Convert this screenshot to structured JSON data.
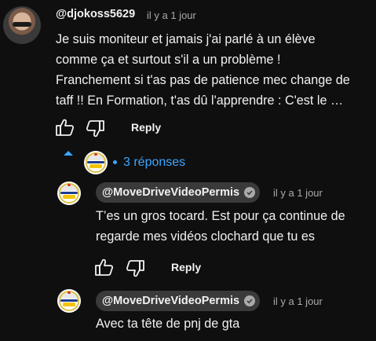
{
  "comment": {
    "author": "@djokoss5629",
    "time": "il y a 1 jour",
    "lines": [
      "Je suis moniteur et jamais j'ai parlé à un élève",
      "comme ça et surtout s'il a un problème !",
      "Franchement si t'as pas de patience mec change de",
      "taff !! En Formation, t'as dû l'apprendre : C'est le …"
    ],
    "reply_label": "Reply"
  },
  "replies_toggle": {
    "label": "3 réponses"
  },
  "replies": [
    {
      "author": "@MoveDriveVideoPermis",
      "time": "il y a 1 jour",
      "lines": [
        "T’es un gros tocard. Est pour ça continue de",
        "regarde mes vidéos clochard que tu es"
      ],
      "reply_label": "Reply"
    },
    {
      "author": "@MoveDriveVideoPermis",
      "time": "il y a 1 jour",
      "lines": [
        "Avec ta tête de pnj de gta"
      ]
    }
  ],
  "colors": {
    "background": "#0f0f0f",
    "text": "#f1f1f1",
    "muted": "#aaaaaa",
    "link": "#3ea6ff",
    "pill": "#3a3a3a"
  },
  "icons": [
    "like-icon",
    "dislike-icon",
    "chevron-up-icon",
    "verified-check-icon"
  ]
}
